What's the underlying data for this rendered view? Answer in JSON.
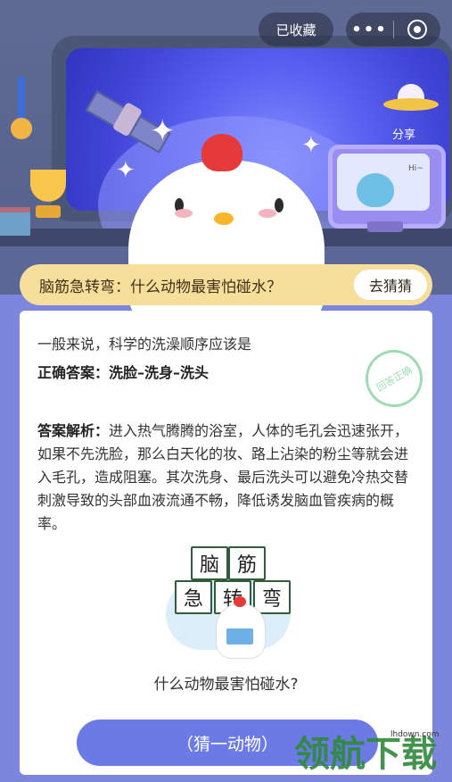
{
  "topbar": {
    "favorite_label": "已收藏",
    "more_icon": "more-dots-icon",
    "close_icon": "target-close-icon"
  },
  "scene": {
    "share_label": "分享",
    "tv_greeting": "Hi~"
  },
  "banner": {
    "question": "脑筋急转弯：什么动物最害怕碰水？",
    "guess_button": "去猜猜"
  },
  "card": {
    "lead": "一般来说，科学的洗澡顺序应该是",
    "answer_label": "正确答案：",
    "answer_value": "洗脸–洗身–洗头",
    "stamp": "回答正确",
    "analysis_label": "答案解析：",
    "analysis_text": "进入热气腾腾的浴室，人体的毛孔会迅速张开，如果不先洗脸，那么白天化的妆、路上沾染的粉尘等就会进入毛孔，造成阻塞。其次洗身、最后洗头可以避免冷热交替刺激导致的头部血液流通不畅，降低诱发脑血管疾病的概率。",
    "tiles": [
      "脑",
      "筋",
      "急",
      "转",
      "弯"
    ],
    "illus_question": "什么动物最害怕碰水?",
    "animal_button": "（猜一动物）"
  },
  "watermark": {
    "text": "领航下载",
    "url": "lhdown.com"
  },
  "colors": {
    "accent": "#6c7ae6",
    "banner": "#f6df9a",
    "comb": "#e63a3a"
  }
}
